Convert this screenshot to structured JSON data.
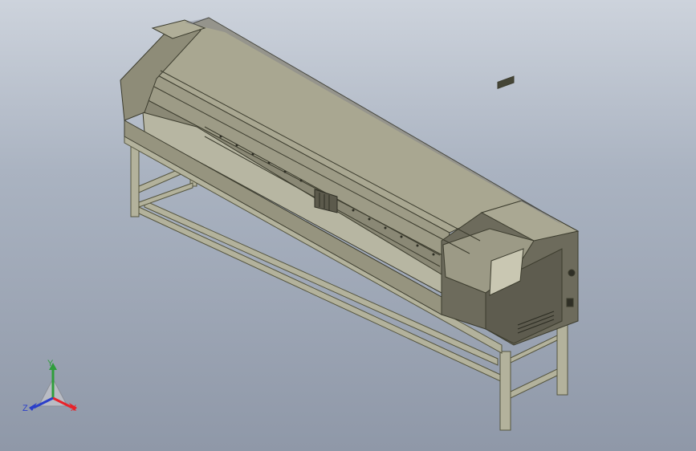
{
  "viewport": {
    "background_top": "#cdd3dc",
    "background_bottom": "#8f98a8",
    "model_color": "#9c9a86"
  },
  "triad": {
    "x_label": "X",
    "y_label": "Y",
    "z_label": "Z",
    "x_color": "#e8232a",
    "y_color": "#2f9e3c",
    "z_color": "#2b3fc9"
  }
}
